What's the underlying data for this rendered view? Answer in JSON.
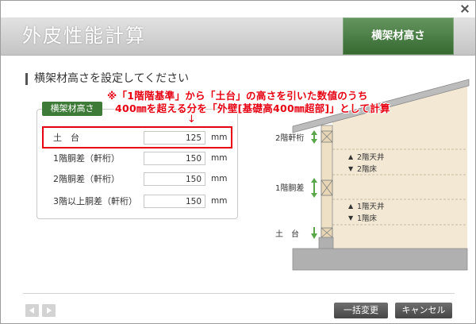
{
  "window": {
    "close_icon": "close-icon"
  },
  "header": {
    "title": "外皮性能計算",
    "active_tab": "横架材高さ"
  },
  "section": {
    "heading": "横架材高さを設定してください"
  },
  "annotation": {
    "line1": "※「1階階基準」から「土台」の高さを引いた数値のうち",
    "line2": "400㎜を超える分を「外壁[基礎高400㎜超部]」として計算",
    "arrow": "↓"
  },
  "panel": {
    "label": "横架材高さ",
    "rows": [
      {
        "label": "土　台",
        "value": "125",
        "unit": "mm"
      },
      {
        "label": "1階胴差（軒桁）",
        "value": "150",
        "unit": "mm"
      },
      {
        "label": "2階胴差（軒桁）",
        "value": "150",
        "unit": "mm"
      },
      {
        "label": "3階以上胴差（軒桁）",
        "value": "150",
        "unit": "mm"
      }
    ]
  },
  "diagram": {
    "beams": [
      {
        "label": "2階軒桁",
        "icon": "double-arrow-icon"
      },
      {
        "label": "1階胴差",
        "icon": "double-arrow-icon"
      },
      {
        "label": "土　台",
        "icon": "down-arrow-icon"
      }
    ],
    "levels": [
      {
        "marker": "▲",
        "label": "2階天井"
      },
      {
        "marker": "▼",
        "label": "2階床"
      },
      {
        "marker": "▲",
        "label": "1階天井"
      },
      {
        "marker": "▼",
        "label": "1階床"
      }
    ]
  },
  "footer": {
    "prev_icon": "prev-arrow-icon",
    "next_icon": "next-arrow-icon",
    "bulk_change_label": "一括変更",
    "cancel_label": "キャンセル"
  },
  "colors": {
    "accent_green": "#3e7b38",
    "highlight_red": "#e60012",
    "button_dark": "#555555",
    "wall_beige": "#f3e8d4",
    "arrow_green": "#5aa64a"
  }
}
